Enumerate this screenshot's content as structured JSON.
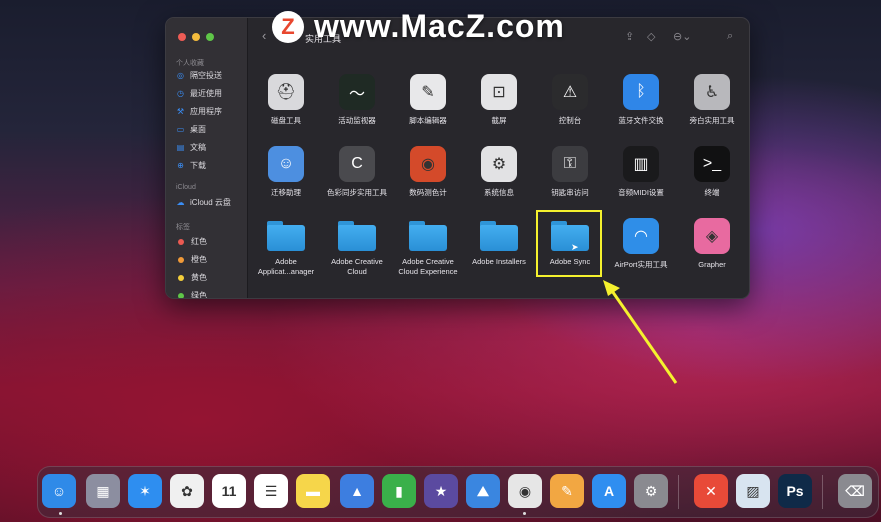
{
  "watermark": {
    "logo_letter": "Z",
    "text": "www.MacZ.com"
  },
  "window": {
    "path_title": "实用工具",
    "sidebar": {
      "favorites_header": "个人收藏",
      "favorites": [
        {
          "label": "隔空投送",
          "icon": "airdrop-icon",
          "glyph": "◎"
        },
        {
          "label": "最近使用",
          "icon": "clock-icon",
          "glyph": "◷"
        },
        {
          "label": "应用程序",
          "icon": "applications-icon",
          "glyph": "⚒"
        },
        {
          "label": "桌面",
          "icon": "desktop-icon",
          "glyph": "▭"
        },
        {
          "label": "文稿",
          "icon": "document-icon",
          "glyph": "▤"
        },
        {
          "label": "下载",
          "icon": "download-icon",
          "glyph": "⊕"
        }
      ],
      "icloud_header": "iCloud",
      "icloud_items": [
        {
          "label": "iCloud 云盘",
          "icon": "cloud-icon",
          "glyph": "☁"
        }
      ],
      "tags_header": "标签",
      "tags": [
        {
          "label": "红色",
          "color": "#ec5a52"
        },
        {
          "label": "橙色",
          "color": "#f19a38"
        },
        {
          "label": "黄色",
          "color": "#f4cf3b"
        },
        {
          "label": "绿色",
          "color": "#5fc648"
        }
      ]
    },
    "items": [
      {
        "label": "磁盘工具",
        "icon": "disk-utility-icon",
        "glyph": "⛑",
        "bg": "#d9d9dc"
      },
      {
        "label": "活动监视器",
        "icon": "activity-monitor-icon",
        "glyph": "〜",
        "bg": "#1f2a24"
      },
      {
        "label": "脚本编辑器",
        "icon": "script-editor-icon",
        "glyph": "✎",
        "bg": "#e8e8ea"
      },
      {
        "label": "截屏",
        "icon": "screenshot-icon",
        "glyph": "⊡",
        "bg": "#e4e4e6"
      },
      {
        "label": "控制台",
        "icon": "console-icon",
        "glyph": "⚠",
        "bg": "#2b2b2d"
      },
      {
        "label": "蓝牙文件交换",
        "icon": "bluetooth-icon",
        "glyph": "ᛒ",
        "bg": "#2f86e8"
      },
      {
        "label": "旁白实用工具",
        "icon": "voiceover-icon",
        "glyph": "♿",
        "bg": "#b8b8bc"
      },
      {
        "label": "迁移助理",
        "icon": "migration-assistant-icon",
        "glyph": "☺",
        "bg": "#4d8fe0"
      },
      {
        "label": "色彩同步实用工具",
        "icon": "colorsync-icon",
        "glyph": "C",
        "bg": "#4a4a4e"
      },
      {
        "label": "数码测色计",
        "icon": "color-meter-icon",
        "glyph": "◉",
        "bg": "#d44a2a"
      },
      {
        "label": "系统信息",
        "icon": "system-info-icon",
        "glyph": "⚙",
        "bg": "#e2e2e4"
      },
      {
        "label": "钥匙串访问",
        "icon": "keychain-icon",
        "glyph": "⚿",
        "bg": "#3c3c40"
      },
      {
        "label": "音频MIDI设置",
        "icon": "midi-keyboard-icon",
        "glyph": "▥",
        "bg": "#1a1a1c"
      },
      {
        "label": "终端",
        "icon": "terminal-icon",
        "glyph": ">_",
        "bg": "#111112"
      }
    ],
    "folders": [
      {
        "label": "Adobe Applicat...anager"
      },
      {
        "label": "Adobe Creative Cloud"
      },
      {
        "label": "Adobe Creative Cloud Experience"
      },
      {
        "label": "Adobe Installers"
      },
      {
        "label": "Adobe Sync"
      }
    ],
    "extra_items": [
      {
        "label": "AirPort实用工具",
        "icon": "airport-wifi-icon",
        "glyph": "◠",
        "bg": "#2f8ee8"
      },
      {
        "label": "Grapher",
        "icon": "grapher-icon",
        "glyph": "◈",
        "bg": "#e86aa0"
      }
    ]
  },
  "dock": [
    {
      "name": "finder",
      "glyph": "☺",
      "bg": "#2f8ae8"
    },
    {
      "name": "launchpad",
      "glyph": "▦",
      "bg": "#8c8ea0"
    },
    {
      "name": "safari",
      "glyph": "✶",
      "bg": "#2e8ef0"
    },
    {
      "name": "photos",
      "glyph": "✿",
      "bg": "#f0f0f0"
    },
    {
      "name": "calendar",
      "glyph": "11",
      "bg": "#ffffff"
    },
    {
      "name": "reminders",
      "glyph": "☰",
      "bg": "#ffffff"
    },
    {
      "name": "notes",
      "glyph": "▬",
      "bg": "#f6d64a"
    },
    {
      "name": "keynote",
      "glyph": "▲",
      "bg": "#3d7ee0"
    },
    {
      "name": "numbers",
      "glyph": "▮",
      "bg": "#3ab04a"
    },
    {
      "name": "imovie",
      "glyph": "★",
      "bg": "#5b4aa0"
    },
    {
      "name": "altimeter",
      "glyph": "⛰",
      "bg": "#3a86e0"
    },
    {
      "name": "chrome",
      "glyph": "◉",
      "bg": "#e6e6e6"
    },
    {
      "name": "pages",
      "glyph": "✎",
      "bg": "#f2a742"
    },
    {
      "name": "app-store",
      "glyph": "A",
      "bg": "#2f8ef0"
    },
    {
      "name": "system-preferences",
      "glyph": "⚙",
      "bg": "#8a8a90"
    },
    {
      "name": "xmind",
      "glyph": "✕",
      "bg": "#e84a38"
    },
    {
      "name": "preview",
      "glyph": "▨",
      "bg": "#d8e4f0"
    },
    {
      "name": "photoshop",
      "glyph": "Ps",
      "bg": "#0f2a48"
    },
    {
      "name": "trash",
      "glyph": "⌫",
      "bg": "#8a8a90"
    }
  ]
}
